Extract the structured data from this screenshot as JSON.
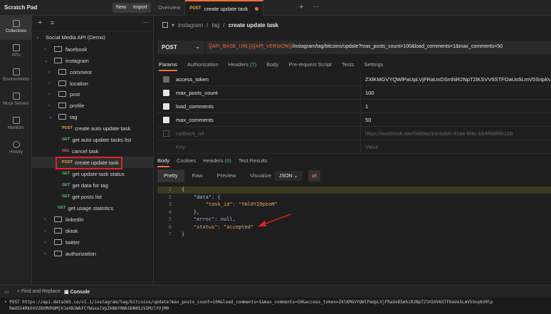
{
  "app": {
    "title": "Scratch Pad",
    "new_label": "New",
    "import_label": "Import"
  },
  "tabs": [
    {
      "label": "Overview"
    },
    {
      "method": "POST",
      "label": "create update task"
    }
  ],
  "rail": [
    {
      "label": "Collections",
      "icon": "collections-icon"
    },
    {
      "label": "APIs",
      "icon": "apis-icon"
    },
    {
      "label": "Environments",
      "icon": "environments-icon"
    },
    {
      "label": "Mock Servers",
      "icon": "mock-servers-icon"
    },
    {
      "label": "Monitors",
      "icon": "monitors-icon"
    },
    {
      "label": "History",
      "icon": "history-icon"
    }
  ],
  "sidebar": {
    "collection": "Social Media API (Demo)",
    "tree": [
      {
        "label": "facebook"
      },
      {
        "label": "instagram"
      },
      {
        "label": "comment"
      },
      {
        "label": "location"
      },
      {
        "label": "post"
      },
      {
        "label": "profile"
      },
      {
        "label": "tag"
      },
      {
        "method": "POST",
        "label": "create auto update task"
      },
      {
        "method": "GET",
        "label": "get auto update tasks list"
      },
      {
        "method": "DEL",
        "label": "cancel task"
      },
      {
        "method": "POST",
        "label": "create update task"
      },
      {
        "method": "GET",
        "label": "get update task status"
      },
      {
        "method": "GET",
        "label": "get data for tag"
      },
      {
        "method": "GET",
        "label": "get posts list"
      },
      {
        "method": "GET",
        "label": "get usage statistics"
      },
      {
        "label": "linkedin"
      },
      {
        "label": "tiktok"
      },
      {
        "label": "twitter"
      },
      {
        "label": "authorization"
      }
    ]
  },
  "breadcrumb": {
    "p1": "instagram",
    "sep": "/",
    "p2": "tag",
    "current": "create update task"
  },
  "request": {
    "method": "POST",
    "url_vars": "{{API_BASE_URL}}{{API_VERSION}}",
    "url_rest": "/instagram/tag/bitcoins/update?max_posts_count=100&load_comments=1&max_comments=50"
  },
  "req_tabs": {
    "params": "Params",
    "authorization": "Authorization",
    "headers": "Headers",
    "headers_count": "(7)",
    "body": "Body",
    "prerequest": "Pre-request Script",
    "tests": "Tests",
    "settings": "Settings"
  },
  "params": [
    {
      "key": "access_token",
      "value": "ZXlKMGVYQWlPaUpLVjFRaUxDSmhiR2NpT2lKSVV6STFOaUo5LmV5SnpkV0lp..."
    },
    {
      "key": "max_posts_count",
      "value": "100"
    },
    {
      "key": "load_comments",
      "value": "1"
    },
    {
      "key": "max_comments",
      "value": "50"
    },
    {
      "key": "callback_url",
      "value": "https://webhook.site/0d69a2b3-bab0-41aa-8f4c-bb4f6889616b"
    },
    {
      "key": "Key",
      "value": "Value"
    }
  ],
  "resp_tabs": {
    "body": "Body",
    "cookies": "Cookies",
    "headers": "Headers",
    "headers_count": "(6)",
    "test_results": "Test Results"
  },
  "format": {
    "pretty": "Pretty",
    "raw": "Raw",
    "preview": "Preview",
    "visualize": "Visualize",
    "json": "JSON"
  },
  "response_lines": [
    {
      "n": "1",
      "text": "{"
    },
    {
      "n": "2",
      "text": "    \"data\": {"
    },
    {
      "n": "3",
      "text": "        \"task_id\": \"Yml0Y29pbnM\""
    },
    {
      "n": "4",
      "text": "    },"
    },
    {
      "n": "5",
      "text": "    \"error\": null,"
    },
    {
      "n": "6",
      "text": "    \"status\": \"accepted\""
    },
    {
      "n": "7",
      "text": "}"
    }
  ],
  "bottom": {
    "find_replace": "Find and Replace",
    "console": "Console"
  },
  "console_text": [
    "• POST https://api.data365.co/v1.1/instagram/tag/bitcoins/update?max_posts_count=100&load_comments=1&max_comments=50&access_token=ZXlKMGVYQWlPaUpLVjFRaUxDSmhiR2NpT2lKSVV6STFOaUo5LmV5SnpkV0lp",
    "  RmU5S4RkhVV2RXMVRDMjVJeXB3WkFCYWsxalVpZkN6Y0NkSDN0SzVIMzlYVjM0"
  ],
  "colors": {
    "accent": "#f26b3a",
    "post": "#f0a23a",
    "get": "#5ac46f",
    "delete": "#e05a5a",
    "highlight": "#e02424"
  }
}
